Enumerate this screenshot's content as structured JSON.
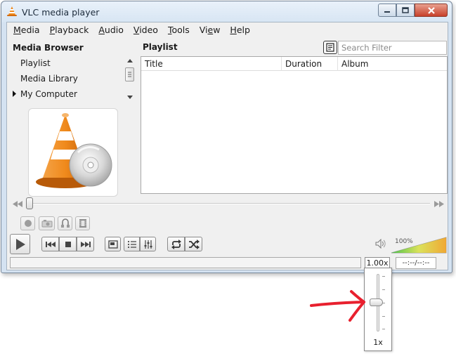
{
  "window": {
    "title": "VLC media player"
  },
  "menu": [
    {
      "prefix": "",
      "ul": "M",
      "rest": "edia"
    },
    {
      "prefix": "",
      "ul": "P",
      "rest": "layback"
    },
    {
      "prefix": "",
      "ul": "A",
      "rest": "udio"
    },
    {
      "prefix": "",
      "ul": "V",
      "rest": "ideo"
    },
    {
      "prefix": "",
      "ul": "T",
      "rest": "ools"
    },
    {
      "prefix": "Vi",
      "ul": "e",
      "rest": "w"
    },
    {
      "prefix": "",
      "ul": "H",
      "rest": "elp"
    }
  ],
  "media_browser": {
    "title": "Media Browser",
    "items": [
      "Playlist",
      "Media Library",
      "My Computer"
    ]
  },
  "playlist": {
    "title": "Playlist",
    "search_placeholder": "Search Filter",
    "columns": [
      "Title",
      "Duration",
      "Album"
    ]
  },
  "volume": {
    "percent_label": "100%",
    "level": 1.0
  },
  "status": {
    "speed": "1.00x",
    "time": "--:--/--:--"
  },
  "speed_popup": {
    "label": "1x",
    "position": 0.5
  },
  "icons": {
    "title_icon": "vlc-cone-icon",
    "artwork": "vlc-cone-with-disc-icon"
  },
  "colors": {
    "accent_orange": "#f08a1c",
    "annotation_red": "#e8202e"
  }
}
